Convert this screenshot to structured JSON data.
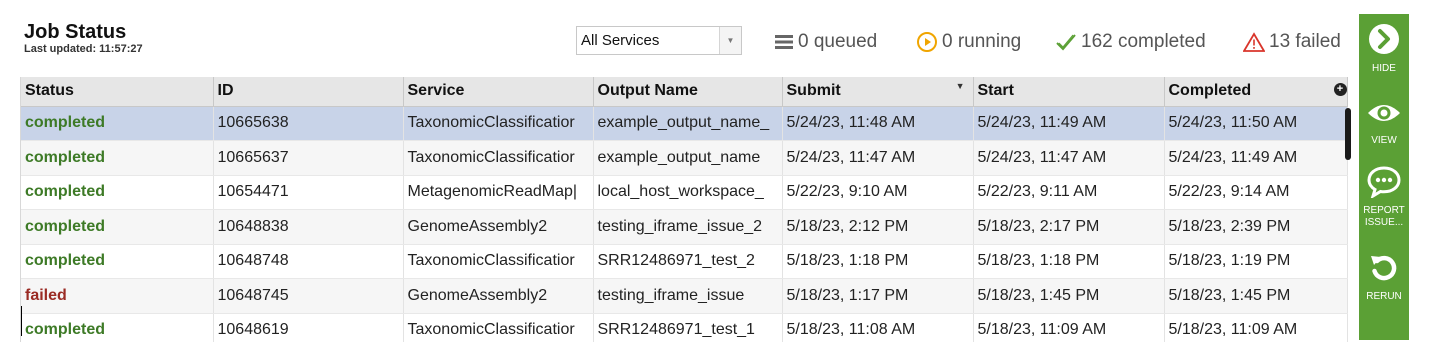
{
  "header": {
    "title": "Job Status",
    "last_updated": "Last updated: 11:57:27"
  },
  "filter": {
    "selected": "All Services"
  },
  "stats": {
    "queued": "0 queued",
    "running": "0 running",
    "completed": "162 completed",
    "failed": "13 failed"
  },
  "colors": {
    "sidebar": "#5ba035",
    "completed": "#3d7a26",
    "failed": "#9a2b24",
    "selected_row": "#c8d3e8",
    "running_icon": "#f0a500",
    "failed_icon": "#d9352b"
  },
  "sidebar": {
    "hide": "HIDE",
    "view": "VIEW",
    "report_1": "REPORT",
    "report_2": "ISSUE...",
    "rerun": "RERUN"
  },
  "table": {
    "columns": [
      "Status",
      "ID",
      "Service",
      "Output Name",
      "Submit",
      "Start",
      "Completed"
    ],
    "rows": [
      {
        "status": "completed",
        "id": "10665638",
        "service": "TaxonomicClassificatior",
        "output": "example_output_name_",
        "submit": "5/24/23, 11:48 AM",
        "start": "5/24/23, 11:49 AM",
        "completed": "5/24/23, 11:50 AM"
      },
      {
        "status": "completed",
        "id": "10665637",
        "service": "TaxonomicClassificatior",
        "output": "example_output_name",
        "submit": "5/24/23, 11:47 AM",
        "start": "5/24/23, 11:47 AM",
        "completed": "5/24/23, 11:49 AM"
      },
      {
        "status": "completed",
        "id": "10654471",
        "service": "MetagenomicReadMap|",
        "output": "local_host_workspace_",
        "submit": "5/22/23, 9:10 AM",
        "start": "5/22/23, 9:11 AM",
        "completed": "5/22/23, 9:14 AM"
      },
      {
        "status": "completed",
        "id": "10648838",
        "service": "GenomeAssembly2",
        "output": "testing_iframe_issue_2",
        "submit": "5/18/23, 2:12 PM",
        "start": "5/18/23, 2:17 PM",
        "completed": "5/18/23, 2:39 PM"
      },
      {
        "status": "completed",
        "id": "10648748",
        "service": "TaxonomicClassificatior",
        "output": "SRR12486971_test_2",
        "submit": "5/18/23, 1:18 PM",
        "start": "5/18/23, 1:18 PM",
        "completed": "5/18/23, 1:19 PM"
      },
      {
        "status": "failed",
        "id": "10648745",
        "service": "GenomeAssembly2",
        "output": "testing_iframe_issue",
        "submit": "5/18/23, 1:17 PM",
        "start": "5/18/23, 1:45 PM",
        "completed": "5/18/23, 1:45 PM"
      },
      {
        "status": "completed",
        "id": "10648619",
        "service": "TaxonomicClassificatior",
        "output": "SRR12486971_test_1",
        "submit": "5/18/23, 11:08 AM",
        "start": "5/18/23, 11:09 AM",
        "completed": "5/18/23, 11:09 AM"
      }
    ]
  }
}
